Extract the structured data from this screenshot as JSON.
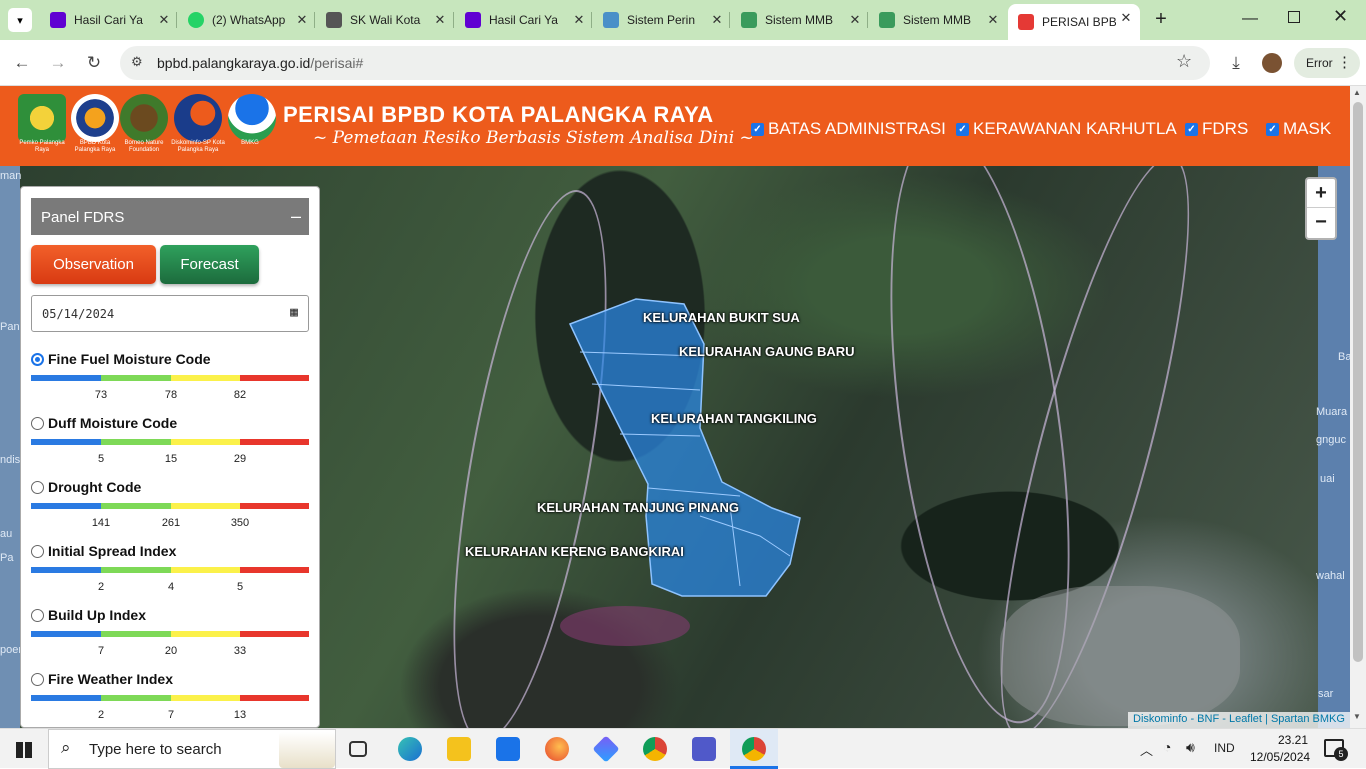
{
  "browser": {
    "tabs": [
      {
        "title": "Hasil Cari Ya",
        "icon": "yahoo-icon",
        "color": "#6001d2"
      },
      {
        "title": "(2) WhatsApp",
        "icon": "whatsapp-icon",
        "color": "#25d366"
      },
      {
        "title": "SK Wali Kota",
        "icon": "site-icon",
        "color": "#555555"
      },
      {
        "title": "Hasil Cari Ya",
        "icon": "yahoo-icon",
        "color": "#6001d2"
      },
      {
        "title": "Sistem Perin",
        "icon": "site-icon",
        "color": "#4a90c8"
      },
      {
        "title": "Sistem MMB",
        "icon": "site-icon",
        "color": "#3a9b5c"
      },
      {
        "title": "Sistem MMB",
        "icon": "site-icon",
        "color": "#3a9b5c"
      },
      {
        "title": "PERISAI BPBD",
        "icon": "bpbd-icon",
        "color": "#e53935"
      }
    ],
    "url_host": "bpbd.palangkaraya.go.id",
    "url_path": "/perisai#",
    "error_label": "Error"
  },
  "header": {
    "title": "PERISAI BPBD KOTA PALANGKA RAYA",
    "subtitle": "~ Pemetaan Resiko Berbasis Sistem Analisa Dini ~",
    "logos": [
      {
        "caption": "Pemko Palangka Raya"
      },
      {
        "caption": "BPBD Kota Palangka Raya"
      },
      {
        "caption": "Borneo Nature Foundation"
      },
      {
        "caption": "Diskominfo-SP Kota Palangka Raya"
      },
      {
        "caption": "BMKG"
      }
    ],
    "layers": [
      "BATAS ADMINISTRASI",
      "KERAWANAN KARHUTLA",
      "FDRS",
      "MASK"
    ]
  },
  "panel": {
    "title": "Panel FDRS",
    "observation_label": "Observation",
    "forecast_label": "Forecast",
    "date": "05/14/2024",
    "indices": [
      {
        "name": "Fine Fuel Moisture Code",
        "ticks": [
          "73",
          "78",
          "82"
        ],
        "selected": true
      },
      {
        "name": "Duff Moisture Code",
        "ticks": [
          "5",
          "15",
          "29"
        ],
        "selected": false
      },
      {
        "name": "Drought Code",
        "ticks": [
          "141",
          "261",
          "350"
        ],
        "selected": false
      },
      {
        "name": "Initial Spread Index",
        "ticks": [
          "2",
          "4",
          "5"
        ],
        "selected": false
      },
      {
        "name": "Build Up Index",
        "ticks": [
          "7",
          "20",
          "33"
        ],
        "selected": false
      },
      {
        "name": "Fire Weather Index",
        "ticks": [
          "2",
          "7",
          "13"
        ],
        "selected": false
      }
    ],
    "colors": [
      "#2a7ae2",
      "#7ed957",
      "#fbf14a",
      "#e8362c"
    ]
  },
  "map": {
    "kelurahan": [
      "KELURAHAN BUKIT SUA",
      "KELURAHAN GAUNG BARU",
      "KELURAHAN TANGKILING",
      "KELURAHAN TANJUNG PINANG",
      "KELURAHAN KERENG BANGKIRAI"
    ],
    "zoom_in": "+",
    "zoom_out": "−",
    "attribution": "Diskominfo - BNF - Leaflet | Spartan BMKG",
    "edge_labels_left": [
      "man",
      "Pan",
      "ndis",
      "au",
      "Pa",
      "poer"
    ],
    "edge_labels_right": [
      "Ba",
      "Muara",
      "gnguc",
      "uai",
      "wahal",
      "sar"
    ]
  },
  "taskbar": {
    "search_placeholder": "Type here to search",
    "language": "IND",
    "time": "23.21",
    "date": "12/05/2024",
    "notifications": "5"
  }
}
